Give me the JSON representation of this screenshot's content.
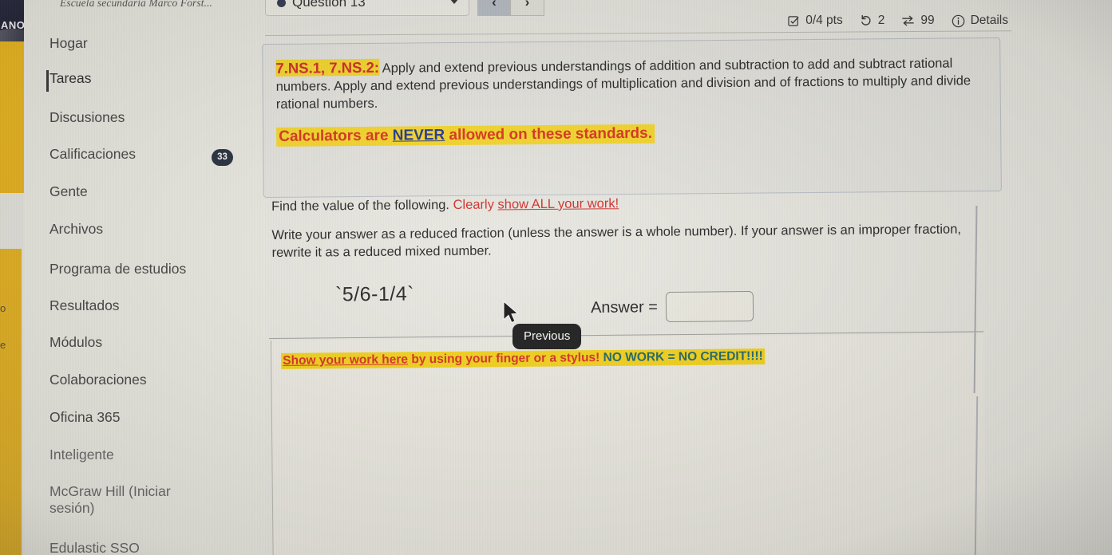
{
  "left_edge": {
    "logo_text": "ANO",
    "letter_o": "o",
    "letter_e": "e"
  },
  "sidebar": {
    "breadcrumb": "Escuela secundaria Marco Forst...",
    "items": [
      {
        "label": "Hogar",
        "active": false,
        "badge": ""
      },
      {
        "label": "Tareas",
        "active": true,
        "badge": ""
      },
      {
        "label": "Discusiones",
        "active": false,
        "badge": ""
      },
      {
        "label": "Calificaciones",
        "active": false,
        "badge": "33"
      },
      {
        "label": "Gente",
        "active": false,
        "badge": ""
      },
      {
        "label": "Archivos",
        "active": false,
        "badge": ""
      },
      {
        "label": "Programa de estudios",
        "active": false,
        "badge": ""
      },
      {
        "label": "Resultados",
        "active": false,
        "badge": ""
      },
      {
        "label": "Módulos",
        "active": false,
        "badge": ""
      },
      {
        "label": "Colaboraciones",
        "active": false,
        "badge": ""
      },
      {
        "label": "Oficina 365",
        "active": false,
        "badge": ""
      },
      {
        "label": "Inteligente",
        "active": false,
        "badge": ""
      },
      {
        "label": "McGraw Hill (Iniciar sesión)",
        "active": false,
        "badge": ""
      },
      {
        "label": "Edulastic SSO",
        "active": false,
        "badge": ""
      }
    ]
  },
  "question_header": {
    "label": "Question 13",
    "dropdown_icon": "chevron-down-icon",
    "prev_label": "‹",
    "next_label": "›"
  },
  "meta": {
    "points": "0/4 pts",
    "attempts": "2",
    "retries": "99",
    "details_label": "Details"
  },
  "standard": {
    "code": "7.NS.1, 7.NS.2:",
    "body": " Apply and extend previous understandings of addition and subtraction to add and subtract rational numbers. Apply and extend previous understandings of multiplication and division and of fractions to multiply and divide rational numbers.",
    "warning_pre": "Calculators are ",
    "warning_never": "NEVER",
    "warning_post": " allowed on these standards."
  },
  "prompt": {
    "line1_black": "Find the value of the following. ",
    "line1_red_pre": "Clearly ",
    "line1_red_underlined": "show ALL your work!",
    "line2": "Write your answer as a reduced fraction (unless the answer is a whole number).  If your answer is an improper fraction, rewrite it as a reduced mixed number."
  },
  "expression": "`5/6-1/4`",
  "answer": {
    "label": "Answer =",
    "value": "",
    "placeholder": ""
  },
  "work": {
    "caption_underlined": "Show your work here",
    "caption_red_rest": " by using your finger or a stylus!",
    "caption_teal": "  NO WORK = NO CREDIT!!!!"
  },
  "tooltip": {
    "text": "Previous"
  },
  "colors": {
    "highlight_yellow": "#f7d620",
    "standard_red": "#cf2020",
    "never_blue": "#1c2f86",
    "prompt_red": "#d2231f",
    "no_credit_teal": "#155f63",
    "badge_dark": "#1c2433",
    "gold_strip": "#eab211",
    "logo_navy": "#1a1d33"
  }
}
